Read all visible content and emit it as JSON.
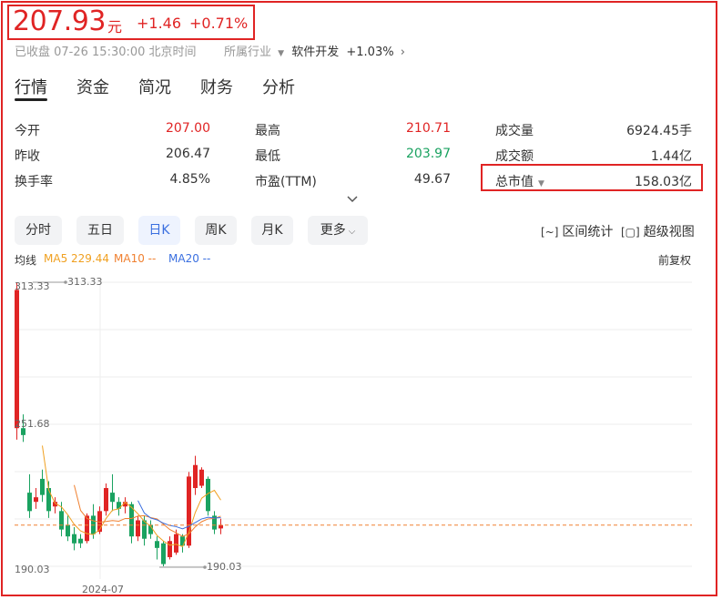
{
  "quote": {
    "price": "207.93",
    "unit": "元",
    "change": "+1.46",
    "change_pct": "+0.71%",
    "status": "已收盘 07-26 15:30:00 北京时间",
    "industry_label": "所属行业",
    "industry_name": "软件开发",
    "industry_change": "+1.03%",
    "up_color": "#e02424",
    "down_color": "#1aa260"
  },
  "tabs": [
    "行情",
    "资金",
    "简况",
    "财务",
    "分析"
  ],
  "stats": [
    {
      "label": "今开",
      "value": "207.00",
      "tone": "up"
    },
    {
      "label": "最高",
      "value": "210.71",
      "tone": "up"
    },
    {
      "label": "成交量",
      "value": "6924.45手",
      "tone": ""
    },
    {
      "label": "昨收",
      "value": "206.47",
      "tone": ""
    },
    {
      "label": "最低",
      "value": "203.97",
      "tone": "down"
    },
    {
      "label": "成交额",
      "value": "1.44亿",
      "tone": ""
    },
    {
      "label": "换手率",
      "value": "4.85%",
      "tone": ""
    },
    {
      "label": "市盈(TTM)",
      "value": "49.67",
      "tone": ""
    },
    {
      "label": "总市值",
      "value": "158.03亿",
      "tone": ""
    }
  ],
  "periods": [
    "分时",
    "五日",
    "日K",
    "周K",
    "月K",
    "更多"
  ],
  "active_period": "日K",
  "tools": {
    "range_stats": "区间统计",
    "super_view": "超级视图"
  },
  "legend": {
    "ma_label": "均线",
    "ma5": "MA5 229.44",
    "ma10": "MA10 --",
    "ma20": "MA20 --",
    "adjust": "前复权",
    "ma5_color": "#f0a020",
    "ma10_color": "#f08030",
    "ma20_color": "#3a6fe0"
  },
  "chart_data": {
    "type": "candlestick",
    "y_ticks": [
      "313.33",
      "251.68",
      "190.03"
    ],
    "ylim": [
      190.03,
      313.33
    ],
    "x_tick": "2024-07",
    "max_label": "313.33",
    "min_label": "190.03",
    "last_close": 207.93,
    "candles": [
      {
        "o": 250,
        "h": 313.33,
        "l": 245,
        "c": 310
      },
      {
        "o": 250,
        "h": 256,
        "l": 244,
        "c": 247
      },
      {
        "o": 222,
        "h": 230,
        "l": 211,
        "c": 214
      },
      {
        "o": 218,
        "h": 224,
        "l": 215,
        "c": 220
      },
      {
        "o": 228,
        "h": 232,
        "l": 218,
        "c": 221
      },
      {
        "o": 224,
        "h": 227,
        "l": 211,
        "c": 214
      },
      {
        "o": 216,
        "h": 220,
        "l": 213,
        "c": 218
      },
      {
        "o": 214,
        "h": 218,
        "l": 203,
        "c": 206
      },
      {
        "o": 208,
        "h": 212,
        "l": 201,
        "c": 203
      },
      {
        "o": 204,
        "h": 207,
        "l": 197,
        "c": 200
      },
      {
        "o": 202,
        "h": 204,
        "l": 198,
        "c": 200
      },
      {
        "o": 201,
        "h": 213,
        "l": 200,
        "c": 212
      },
      {
        "o": 212,
        "h": 217,
        "l": 202,
        "c": 204
      },
      {
        "o": 205,
        "h": 216,
        "l": 204,
        "c": 214
      },
      {
        "o": 214,
        "h": 226,
        "l": 212,
        "c": 224
      },
      {
        "o": 222,
        "h": 230,
        "l": 214,
        "c": 218
      },
      {
        "o": 218,
        "h": 220,
        "l": 212,
        "c": 215
      },
      {
        "o": 216,
        "h": 220,
        "l": 213,
        "c": 218
      },
      {
        "o": 217,
        "h": 218,
        "l": 200,
        "c": 203
      },
      {
        "o": 203,
        "h": 212,
        "l": 201,
        "c": 210
      },
      {
        "o": 210,
        "h": 212,
        "l": 199,
        "c": 202
      },
      {
        "o": 208,
        "h": 210,
        "l": 202,
        "c": 204
      },
      {
        "o": 201,
        "h": 203,
        "l": 193,
        "c": 198
      },
      {
        "o": 200,
        "h": 201,
        "l": 190.03,
        "c": 191
      },
      {
        "o": 194,
        "h": 203,
        "l": 193,
        "c": 201
      },
      {
        "o": 196,
        "h": 206,
        "l": 195,
        "c": 204
      },
      {
        "o": 203,
        "h": 204,
        "l": 196,
        "c": 199
      },
      {
        "o": 199,
        "h": 231,
        "l": 198,
        "c": 229
      },
      {
        "o": 224,
        "h": 238,
        "l": 221,
        "c": 234
      },
      {
        "o": 225,
        "h": 233,
        "l": 224,
        "c": 232
      },
      {
        "o": 228,
        "h": 229,
        "l": 212,
        "c": 214
      },
      {
        "o": 212,
        "h": 214,
        "l": 204,
        "c": 206
      },
      {
        "o": 206.47,
        "h": 210.71,
        "l": 203.97,
        "c": 207.93
      }
    ]
  }
}
